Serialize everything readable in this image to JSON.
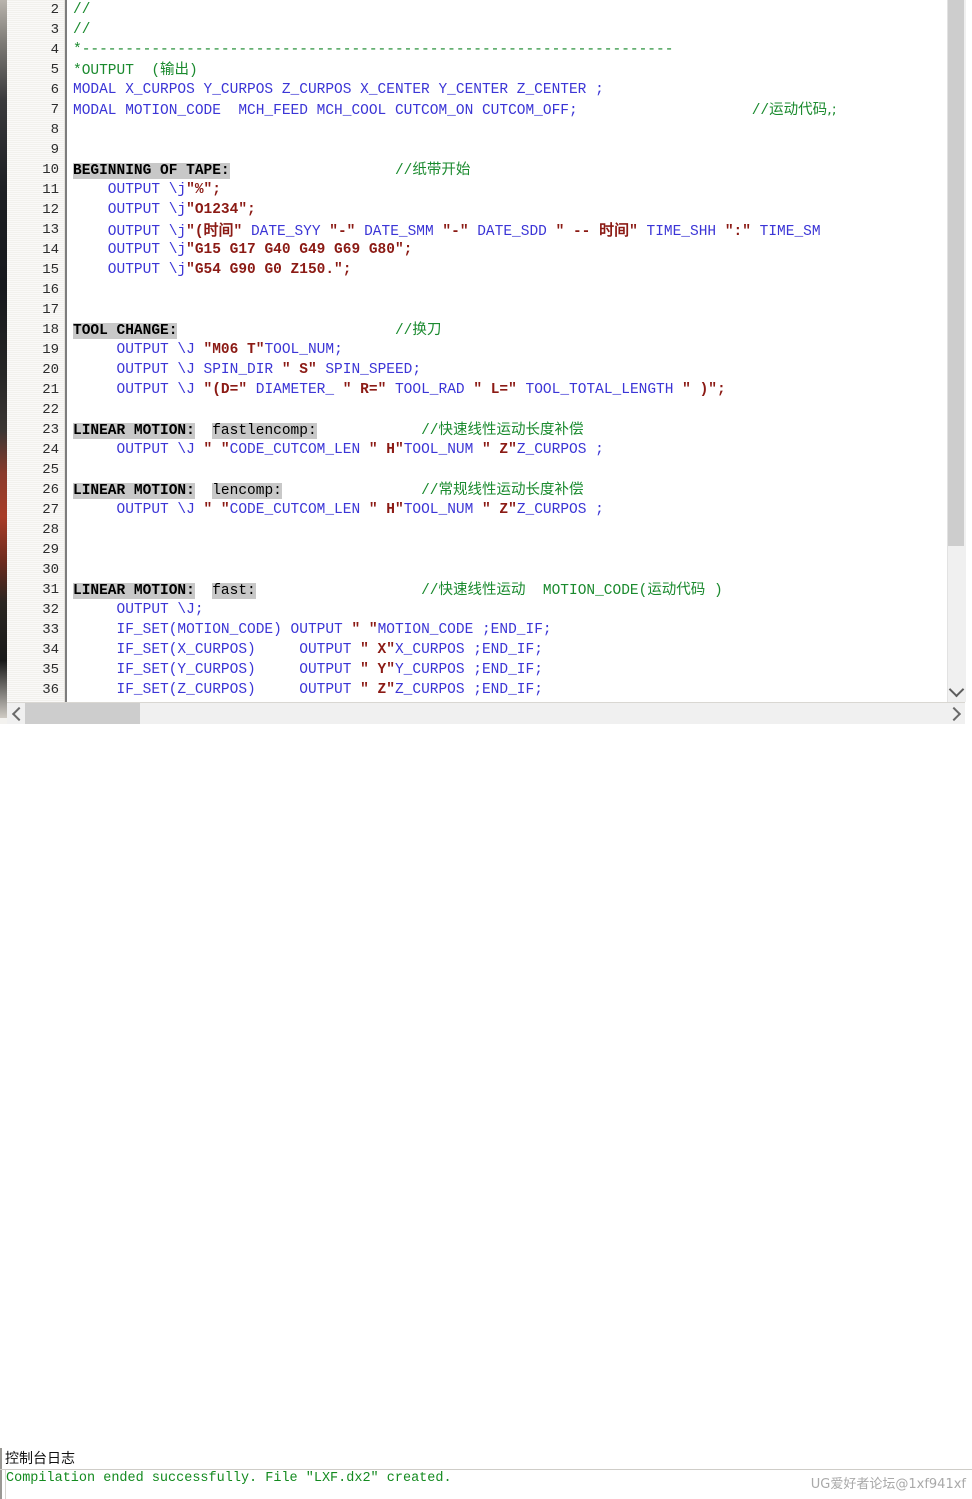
{
  "window": {
    "type": "code-editor",
    "colors": {
      "keyword": "#3b35d6",
      "string": "#8b1a14",
      "comment": "#1a8a2e",
      "label_highlight": "#c8c8c8",
      "console_success": "#138a1f",
      "background": "#ffffff",
      "gutter": "#f2f1ed",
      "scrollbar_thumb": "#cdcdcd"
    }
  },
  "editor": {
    "first_visible_line": 2,
    "last_visible_line": 36,
    "lines": [
      {
        "n": "2",
        "tokens": [
          {
            "t": "//",
            "c": "cmt"
          }
        ]
      },
      {
        "n": "3",
        "tokens": [
          {
            "t": "//",
            "c": "cmt"
          }
        ]
      },
      {
        "n": "4",
        "tokens": [
          {
            "t": "*--------------------------------------------------------------------",
            "c": "cmt"
          }
        ]
      },
      {
        "n": "5",
        "tokens": [
          {
            "t": "*OUTPUT  (",
            "c": "cmt"
          },
          {
            "t": "输出",
            "c": "cmt-cn"
          },
          {
            "t": ")",
            "c": "cmt"
          }
        ]
      },
      {
        "n": "6",
        "tokens": [
          {
            "t": "MODAL X_CURPOS Y_CURPOS Z_CURPOS X_CENTER Y_CENTER Z_CENTER ;",
            "c": "kw"
          }
        ]
      },
      {
        "n": "7",
        "tokens": [
          {
            "t": "MODAL MOTION_CODE  MCH_FEED MCH_COOL CUTCOM_ON CUTCOM_OFF;",
            "c": "kw"
          },
          {
            "t": "                    ",
            "c": "plain"
          },
          {
            "t": "//",
            "c": "cmt"
          },
          {
            "t": "运动代码,;",
            "c": "cmt-cn"
          }
        ]
      },
      {
        "n": "8",
        "tokens": []
      },
      {
        "n": "9",
        "tokens": []
      },
      {
        "n": "10",
        "tokens": [
          {
            "t": "BEGINNING OF TAPE:",
            "c": "lbl"
          },
          {
            "t": "                   ",
            "c": "plain"
          },
          {
            "t": "//",
            "c": "cmt"
          },
          {
            "t": "纸带开始",
            "c": "cmt-cn"
          }
        ]
      },
      {
        "n": "11",
        "tokens": [
          {
            "t": "    OUTPUT ",
            "c": "kw"
          },
          {
            "t": "\\j",
            "c": "kw"
          },
          {
            "t": "\"%\";",
            "c": "str"
          }
        ]
      },
      {
        "n": "12",
        "tokens": [
          {
            "t": "    OUTPUT ",
            "c": "kw"
          },
          {
            "t": "\\j",
            "c": "kw"
          },
          {
            "t": "\"O1234\";",
            "c": "str"
          }
        ]
      },
      {
        "n": "13",
        "tokens": [
          {
            "t": "    OUTPUT ",
            "c": "kw"
          },
          {
            "t": "\\j",
            "c": "kw"
          },
          {
            "t": "\"(",
            "c": "str"
          },
          {
            "t": "时间",
            "c": "strcn"
          },
          {
            "t": "\" ",
            "c": "str"
          },
          {
            "t": "DATE_SYY ",
            "c": "kw"
          },
          {
            "t": "\"-\" ",
            "c": "str"
          },
          {
            "t": "DATE_SMM ",
            "c": "kw"
          },
          {
            "t": "\"-\" ",
            "c": "str"
          },
          {
            "t": "DATE_SDD ",
            "c": "kw"
          },
          {
            "t": "\" -- ",
            "c": "str"
          },
          {
            "t": "时间",
            "c": "strcn"
          },
          {
            "t": "\" ",
            "c": "str"
          },
          {
            "t": "TIME_SHH ",
            "c": "kw"
          },
          {
            "t": "\":\" ",
            "c": "str"
          },
          {
            "t": "TIME_SM",
            "c": "kw"
          }
        ]
      },
      {
        "n": "14",
        "tokens": [
          {
            "t": "    OUTPUT ",
            "c": "kw"
          },
          {
            "t": "\\j",
            "c": "kw"
          },
          {
            "t": "\"G15 G17 G40 G49 G69 G80\";",
            "c": "str"
          }
        ]
      },
      {
        "n": "15",
        "tokens": [
          {
            "t": "    OUTPUT ",
            "c": "kw"
          },
          {
            "t": "\\j",
            "c": "kw"
          },
          {
            "t": "\"G54 G90 G0 Z150.\";",
            "c": "str"
          }
        ]
      },
      {
        "n": "16",
        "tokens": []
      },
      {
        "n": "17",
        "tokens": []
      },
      {
        "n": "18",
        "tokens": [
          {
            "t": "TOOL CHANGE:",
            "c": "lbl"
          },
          {
            "t": "                         ",
            "c": "plain"
          },
          {
            "t": "//",
            "c": "cmt"
          },
          {
            "t": "换刀",
            "c": "cmt-cn"
          }
        ]
      },
      {
        "n": "19",
        "tokens": [
          {
            "t": "     OUTPUT \\J ",
            "c": "kw"
          },
          {
            "t": "\"M06 T\"",
            "c": "str"
          },
          {
            "t": "TOOL_NUM;",
            "c": "kw"
          }
        ]
      },
      {
        "n": "20",
        "tokens": [
          {
            "t": "     OUTPUT \\J SPIN_DIR ",
            "c": "kw"
          },
          {
            "t": "\" S\" ",
            "c": "str"
          },
          {
            "t": "SPIN_SPEED;",
            "c": "kw"
          }
        ]
      },
      {
        "n": "21",
        "tokens": [
          {
            "t": "     OUTPUT \\J ",
            "c": "kw"
          },
          {
            "t": "\"(D=\" ",
            "c": "str"
          },
          {
            "t": "DIAMETER_ ",
            "c": "kw"
          },
          {
            "t": "\" R=\" ",
            "c": "str"
          },
          {
            "t": "TOOL_RAD ",
            "c": "kw"
          },
          {
            "t": "\" L=\" ",
            "c": "str"
          },
          {
            "t": "TOOL_TOTAL_LENGTH ",
            "c": "kw"
          },
          {
            "t": "\" )\";",
            "c": "str"
          }
        ]
      },
      {
        "n": "22",
        "tokens": []
      },
      {
        "n": "23",
        "tokens": [
          {
            "t": "LINEAR MOTION:",
            "c": "lbl"
          },
          {
            "t": "  ",
            "c": "plain"
          },
          {
            "t": "fastlencomp:",
            "c": "lbl2"
          },
          {
            "t": "            ",
            "c": "plain"
          },
          {
            "t": "//",
            "c": "cmt"
          },
          {
            "t": "快速线性运动长度补偿",
            "c": "cmt-cn"
          }
        ]
      },
      {
        "n": "24",
        "tokens": [
          {
            "t": "     OUTPUT \\J ",
            "c": "kw"
          },
          {
            "t": "\" \"",
            "c": "str"
          },
          {
            "t": "CODE_CUTCOM_LEN ",
            "c": "kw"
          },
          {
            "t": "\" H\"",
            "c": "str"
          },
          {
            "t": "TOOL_NUM ",
            "c": "kw"
          },
          {
            "t": "\" Z\"",
            "c": "str"
          },
          {
            "t": "Z_CURPOS ;",
            "c": "kw"
          }
        ]
      },
      {
        "n": "25",
        "tokens": []
      },
      {
        "n": "26",
        "tokens": [
          {
            "t": "LINEAR MOTION:",
            "c": "lbl"
          },
          {
            "t": "  ",
            "c": "plain"
          },
          {
            "t": "lencomp:",
            "c": "lbl2"
          },
          {
            "t": "                ",
            "c": "plain"
          },
          {
            "t": "//",
            "c": "cmt"
          },
          {
            "t": "常规线性运动长度补偿",
            "c": "cmt-cn"
          }
        ]
      },
      {
        "n": "27",
        "tokens": [
          {
            "t": "     OUTPUT \\J ",
            "c": "kw"
          },
          {
            "t": "\" \"",
            "c": "str"
          },
          {
            "t": "CODE_CUTCOM_LEN ",
            "c": "kw"
          },
          {
            "t": "\" H\"",
            "c": "str"
          },
          {
            "t": "TOOL_NUM ",
            "c": "kw"
          },
          {
            "t": "\" Z\"",
            "c": "str"
          },
          {
            "t": "Z_CURPOS ;",
            "c": "kw"
          }
        ]
      },
      {
        "n": "28",
        "tokens": []
      },
      {
        "n": "29",
        "tokens": []
      },
      {
        "n": "30",
        "tokens": []
      },
      {
        "n": "31",
        "tokens": [
          {
            "t": "LINEAR MOTION:",
            "c": "lbl"
          },
          {
            "t": "  ",
            "c": "plain"
          },
          {
            "t": "fast:",
            "c": "lbl2"
          },
          {
            "t": "                   ",
            "c": "plain"
          },
          {
            "t": "//",
            "c": "cmt"
          },
          {
            "t": "快速线性运动",
            "c": "cmt-cn"
          },
          {
            "t": "  MOTION_CODE(",
            "c": "cmt"
          },
          {
            "t": "运动代码",
            "c": "cmt-cn"
          },
          {
            "t": " )",
            "c": "cmt"
          }
        ]
      },
      {
        "n": "32",
        "tokens": [
          {
            "t": "     OUTPUT \\J;",
            "c": "kw"
          }
        ]
      },
      {
        "n": "33",
        "tokens": [
          {
            "t": "     IF_SET(MOTION_CODE) OUTPUT ",
            "c": "kw"
          },
          {
            "t": "\" \"",
            "c": "str"
          },
          {
            "t": "MOTION_CODE ;END_IF;",
            "c": "kw"
          }
        ]
      },
      {
        "n": "34",
        "tokens": [
          {
            "t": "     IF_SET(X_CURPOS)     OUTPUT ",
            "c": "kw"
          },
          {
            "t": "\" X\"",
            "c": "str"
          },
          {
            "t": "X_CURPOS ;END_IF;",
            "c": "kw"
          }
        ]
      },
      {
        "n": "35",
        "tokens": [
          {
            "t": "     IF_SET(Y_CURPOS)     OUTPUT ",
            "c": "kw"
          },
          {
            "t": "\" Y\"",
            "c": "str"
          },
          {
            "t": "Y_CURPOS ;END_IF;",
            "c": "kw"
          }
        ]
      },
      {
        "n": "36",
        "tokens": [
          {
            "t": "     IF_SET(Z_CURPOS)     OUTPUT ",
            "c": "kw"
          },
          {
            "t": "\" Z\"",
            "c": "str"
          },
          {
            "t": "Z_CURPOS ;END_IF;",
            "c": "kw"
          }
        ]
      }
    ]
  },
  "scrollbars": {
    "vertical": {
      "thumb_top_pct": 0,
      "thumb_height_pct": 78,
      "down_arrow": "chevron-down-icon"
    },
    "horizontal": {
      "thumb_left_pct": 2,
      "thumb_width_pct": 12,
      "left_arrow": "chevron-left-icon",
      "right_arrow": "chevron-right-icon"
    }
  },
  "console": {
    "title": "控制台日志",
    "message": "Compilation ended successfully. File \"LXF.dx2\" created."
  },
  "watermark": {
    "text": "UG爱好者论坛@1xf941xf"
  }
}
